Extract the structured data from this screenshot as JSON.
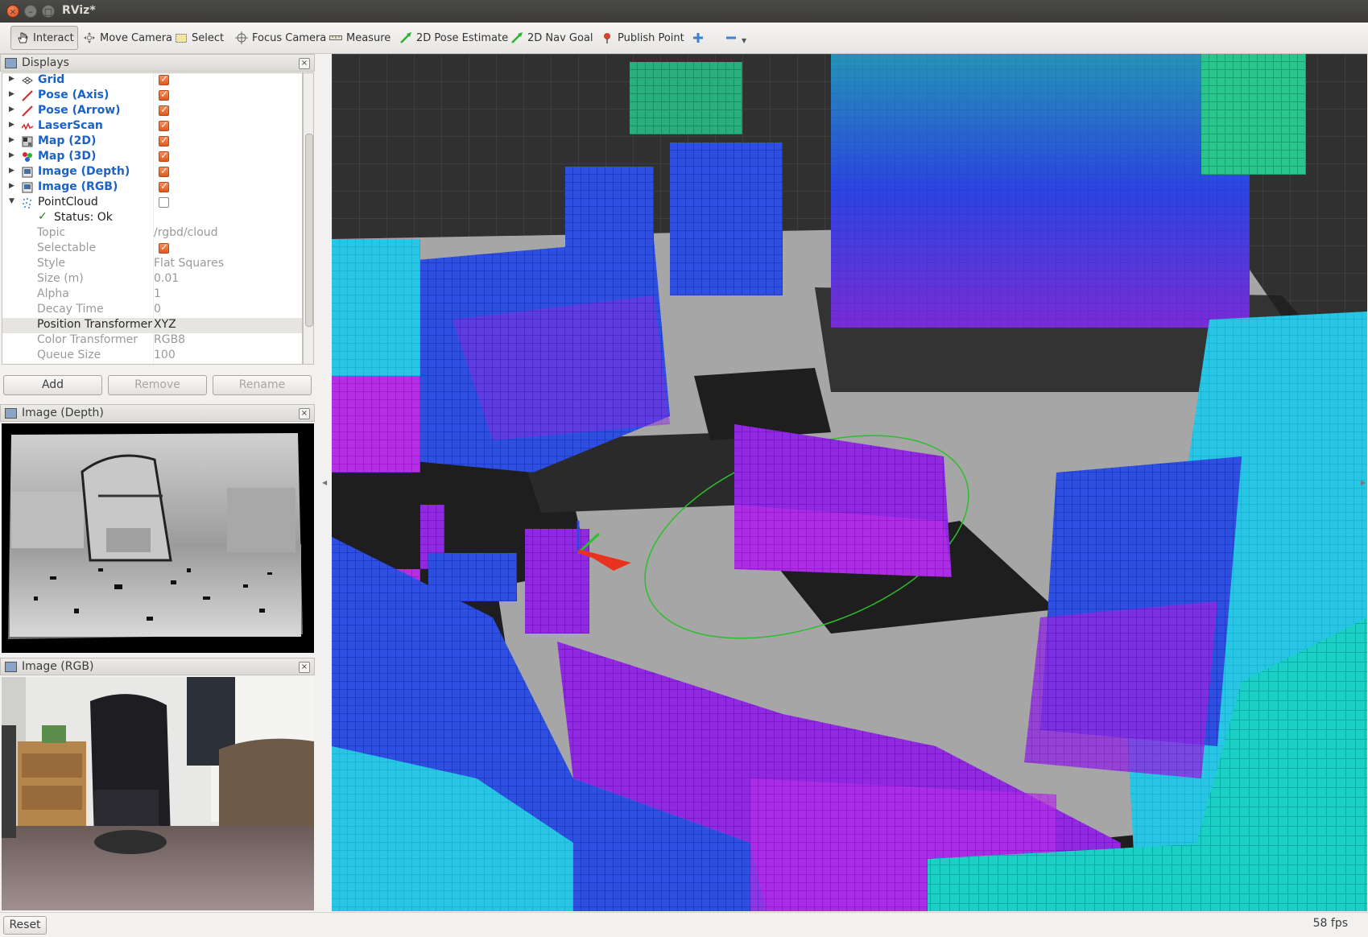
{
  "window": {
    "title": "RViz*"
  },
  "toolbar": {
    "tools": [
      {
        "label": "Interact",
        "icon": "hand-icon"
      },
      {
        "label": "Move Camera",
        "icon": "move-camera-icon"
      },
      {
        "label": "Select",
        "icon": "select-icon"
      },
      {
        "label": "Focus Camera",
        "icon": "focus-camera-icon"
      },
      {
        "label": "Measure",
        "icon": "ruler-icon"
      },
      {
        "label": "2D Pose Estimate",
        "icon": "pose-arrow-icon"
      },
      {
        "label": "2D Nav Goal",
        "icon": "nav-goal-icon"
      },
      {
        "label": "Publish Point",
        "icon": "pin-icon"
      }
    ],
    "active_tool": "Interact"
  },
  "displays": {
    "title": "Displays",
    "items": [
      {
        "name": "Grid",
        "checked": true
      },
      {
        "name": "Pose (Axis)",
        "checked": true
      },
      {
        "name": "Pose (Arrow)",
        "checked": true
      },
      {
        "name": "LaserScan",
        "checked": true
      },
      {
        "name": "Map (2D)",
        "checked": true
      },
      {
        "name": "Map (3D)",
        "checked": true
      },
      {
        "name": "Image (Depth)",
        "checked": true
      },
      {
        "name": "Image (RGB)",
        "checked": true
      },
      {
        "name": "PointCloud",
        "checked": false
      }
    ],
    "pointcloud": {
      "status": "Status: Ok",
      "properties": [
        {
          "key": "Topic",
          "value": "/rgbd/cloud"
        },
        {
          "key": "Selectable",
          "value": ""
        },
        {
          "key": "Style",
          "value": "Flat Squares"
        },
        {
          "key": "Size (m)",
          "value": "0.01"
        },
        {
          "key": "Alpha",
          "value": "1"
        },
        {
          "key": "Decay Time",
          "value": "0"
        },
        {
          "key": "Position Transformer",
          "value": "XYZ"
        },
        {
          "key": "Color Transformer",
          "value": "RGB8"
        },
        {
          "key": "Queue Size",
          "value": "100"
        }
      ]
    },
    "buttons": {
      "add": "Add",
      "remove": "Remove",
      "rename": "Rename"
    }
  },
  "image_depth_panel": {
    "title": "Image (Depth)"
  },
  "image_rgb_panel": {
    "title": "Image (RGB)"
  },
  "statusbar": {
    "reset": "Reset",
    "fps": "58 fps"
  },
  "colors": {
    "accent_orange": "#e05a1e",
    "link_blue": "#1a62c6",
    "grid_bg": "#303030"
  }
}
